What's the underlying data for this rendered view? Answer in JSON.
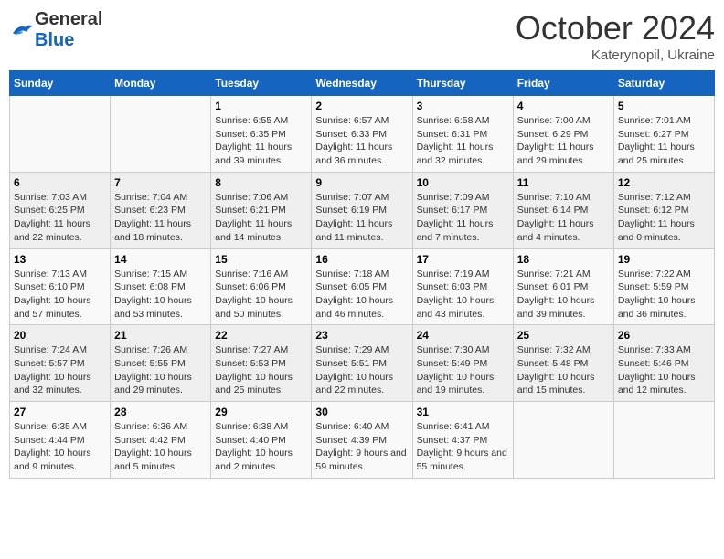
{
  "header": {
    "logo_general": "General",
    "logo_blue": "Blue",
    "month": "October 2024",
    "location": "Katerynopil, Ukraine"
  },
  "weekdays": [
    "Sunday",
    "Monday",
    "Tuesday",
    "Wednesday",
    "Thursday",
    "Friday",
    "Saturday"
  ],
  "weeks": [
    [
      {
        "day": "",
        "info": ""
      },
      {
        "day": "",
        "info": ""
      },
      {
        "day": "1",
        "info": "Sunrise: 6:55 AM\nSunset: 6:35 PM\nDaylight: 11 hours and 39 minutes."
      },
      {
        "day": "2",
        "info": "Sunrise: 6:57 AM\nSunset: 6:33 PM\nDaylight: 11 hours and 36 minutes."
      },
      {
        "day": "3",
        "info": "Sunrise: 6:58 AM\nSunset: 6:31 PM\nDaylight: 11 hours and 32 minutes."
      },
      {
        "day": "4",
        "info": "Sunrise: 7:00 AM\nSunset: 6:29 PM\nDaylight: 11 hours and 29 minutes."
      },
      {
        "day": "5",
        "info": "Sunrise: 7:01 AM\nSunset: 6:27 PM\nDaylight: 11 hours and 25 minutes."
      }
    ],
    [
      {
        "day": "6",
        "info": "Sunrise: 7:03 AM\nSunset: 6:25 PM\nDaylight: 11 hours and 22 minutes."
      },
      {
        "day": "7",
        "info": "Sunrise: 7:04 AM\nSunset: 6:23 PM\nDaylight: 11 hours and 18 minutes."
      },
      {
        "day": "8",
        "info": "Sunrise: 7:06 AM\nSunset: 6:21 PM\nDaylight: 11 hours and 14 minutes."
      },
      {
        "day": "9",
        "info": "Sunrise: 7:07 AM\nSunset: 6:19 PM\nDaylight: 11 hours and 11 minutes."
      },
      {
        "day": "10",
        "info": "Sunrise: 7:09 AM\nSunset: 6:17 PM\nDaylight: 11 hours and 7 minutes."
      },
      {
        "day": "11",
        "info": "Sunrise: 7:10 AM\nSunset: 6:14 PM\nDaylight: 11 hours and 4 minutes."
      },
      {
        "day": "12",
        "info": "Sunrise: 7:12 AM\nSunset: 6:12 PM\nDaylight: 11 hours and 0 minutes."
      }
    ],
    [
      {
        "day": "13",
        "info": "Sunrise: 7:13 AM\nSunset: 6:10 PM\nDaylight: 10 hours and 57 minutes."
      },
      {
        "day": "14",
        "info": "Sunrise: 7:15 AM\nSunset: 6:08 PM\nDaylight: 10 hours and 53 minutes."
      },
      {
        "day": "15",
        "info": "Sunrise: 7:16 AM\nSunset: 6:06 PM\nDaylight: 10 hours and 50 minutes."
      },
      {
        "day": "16",
        "info": "Sunrise: 7:18 AM\nSunset: 6:05 PM\nDaylight: 10 hours and 46 minutes."
      },
      {
        "day": "17",
        "info": "Sunrise: 7:19 AM\nSunset: 6:03 PM\nDaylight: 10 hours and 43 minutes."
      },
      {
        "day": "18",
        "info": "Sunrise: 7:21 AM\nSunset: 6:01 PM\nDaylight: 10 hours and 39 minutes."
      },
      {
        "day": "19",
        "info": "Sunrise: 7:22 AM\nSunset: 5:59 PM\nDaylight: 10 hours and 36 minutes."
      }
    ],
    [
      {
        "day": "20",
        "info": "Sunrise: 7:24 AM\nSunset: 5:57 PM\nDaylight: 10 hours and 32 minutes."
      },
      {
        "day": "21",
        "info": "Sunrise: 7:26 AM\nSunset: 5:55 PM\nDaylight: 10 hours and 29 minutes."
      },
      {
        "day": "22",
        "info": "Sunrise: 7:27 AM\nSunset: 5:53 PM\nDaylight: 10 hours and 25 minutes."
      },
      {
        "day": "23",
        "info": "Sunrise: 7:29 AM\nSunset: 5:51 PM\nDaylight: 10 hours and 22 minutes."
      },
      {
        "day": "24",
        "info": "Sunrise: 7:30 AM\nSunset: 5:49 PM\nDaylight: 10 hours and 19 minutes."
      },
      {
        "day": "25",
        "info": "Sunrise: 7:32 AM\nSunset: 5:48 PM\nDaylight: 10 hours and 15 minutes."
      },
      {
        "day": "26",
        "info": "Sunrise: 7:33 AM\nSunset: 5:46 PM\nDaylight: 10 hours and 12 minutes."
      }
    ],
    [
      {
        "day": "27",
        "info": "Sunrise: 6:35 AM\nSunset: 4:44 PM\nDaylight: 10 hours and 9 minutes."
      },
      {
        "day": "28",
        "info": "Sunrise: 6:36 AM\nSunset: 4:42 PM\nDaylight: 10 hours and 5 minutes."
      },
      {
        "day": "29",
        "info": "Sunrise: 6:38 AM\nSunset: 4:40 PM\nDaylight: 10 hours and 2 minutes."
      },
      {
        "day": "30",
        "info": "Sunrise: 6:40 AM\nSunset: 4:39 PM\nDaylight: 9 hours and 59 minutes."
      },
      {
        "day": "31",
        "info": "Sunrise: 6:41 AM\nSunset: 4:37 PM\nDaylight: 9 hours and 55 minutes."
      },
      {
        "day": "",
        "info": ""
      },
      {
        "day": "",
        "info": ""
      }
    ]
  ]
}
